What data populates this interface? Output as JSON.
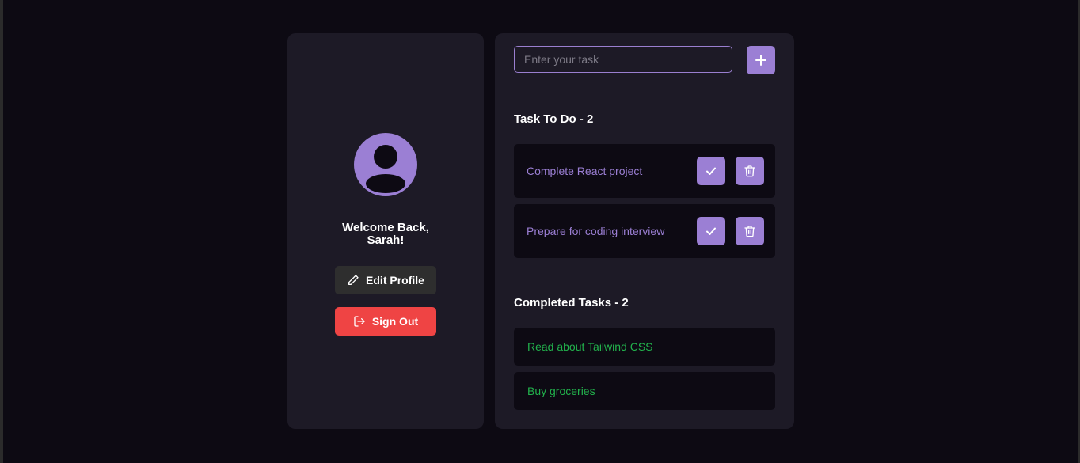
{
  "profile": {
    "welcome_line1": "Welcome Back,",
    "welcome_line2": "Sarah!",
    "edit_label": "Edit Profile",
    "signout_label": "Sign Out",
    "avatar_icon": "user-avatar-icon"
  },
  "input": {
    "placeholder": "Enter your task",
    "add_icon": "plus-icon"
  },
  "todo": {
    "title": "Task To Do - 2",
    "items": [
      {
        "label": "Complete React project"
      },
      {
        "label": "Prepare for coding interview"
      }
    ]
  },
  "completed": {
    "title": "Completed Tasks - 2",
    "items": [
      {
        "label": "Read about Tailwind CSS"
      },
      {
        "label": "Buy groceries"
      }
    ]
  },
  "colors": {
    "background": "#0d0a13",
    "card": "#1d1a26",
    "accent": "#9b7fd4",
    "danger": "#ef4444",
    "success": "#22b24c"
  }
}
